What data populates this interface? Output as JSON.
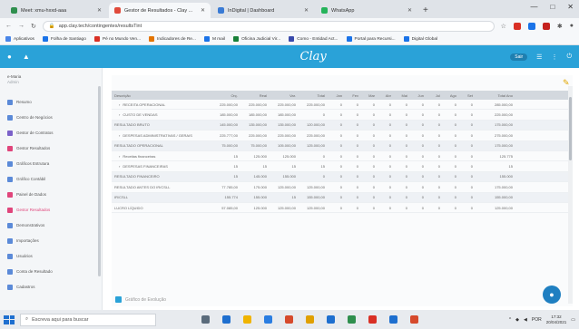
{
  "browser": {
    "tabs": [
      {
        "label": "Meet: xmu-hxxd-aaa",
        "active": false,
        "color": "#2f8f4e"
      },
      {
        "label": "Gestor de Resultados - Clay ...",
        "active": true,
        "color": "#e04a3b"
      },
      {
        "label": "InDigital | Dashboard",
        "active": false,
        "color": "#3a7bd5"
      },
      {
        "label": "WhatsApp",
        "active": false,
        "color": "#25b35a"
      }
    ],
    "new_tab": "+",
    "window_controls": [
      "—",
      "□",
      "✕"
    ],
    "address": "app.clay.tech/contingentes/resultsTint",
    "bookmarks": [
      {
        "label": "Aplicativos",
        "color": "#4a86e8"
      },
      {
        "label": "Folha de Santiago",
        "color": "#1a73e8"
      },
      {
        "label": "Pé no Mundo Ven...",
        "color": "#d93025"
      },
      {
        "label": "Indicadores de Re...",
        "color": "#e37400"
      },
      {
        "label": "M mail",
        "color": "#1a73e8"
      },
      {
        "label": "Oficina Judicial Vir...",
        "color": "#188038"
      },
      {
        "label": "Como - Entidad Act...",
        "color": "#3949ab"
      },
      {
        "label": "Portal para Recursi...",
        "color": "#1a73e8"
      },
      {
        "label": "Digital Global",
        "color": "#1a73e8"
      }
    ]
  },
  "app": {
    "brand": "Clay",
    "header_right_chip": "Sair",
    "accent": "#2aa2d8"
  },
  "sidebar": {
    "user": "e-Maria",
    "user_sub": "Admin",
    "items": [
      {
        "label": "Resumo",
        "color": "#5b8ad8"
      },
      {
        "label": "Centro de Negócios",
        "color": "#5b8ad8"
      },
      {
        "label": "Gestor de Contratos",
        "color": "#7b61c9"
      },
      {
        "label": "Gestor Resultados",
        "color": "#e0457b"
      },
      {
        "label": "Gráficos Estrutura",
        "color": "#5b8ad8"
      },
      {
        "label": "Gráfico Contábil",
        "color": "#5b8ad8"
      },
      {
        "label": "Painel de Dados",
        "color": "#e0457b"
      },
      {
        "label": "Gestor Resultados",
        "color": "#e0457b",
        "active": true
      },
      {
        "label": "Demonstrativos",
        "color": "#5b8ad8"
      },
      {
        "label": "Importações",
        "color": "#5b8ad8"
      },
      {
        "label": "Usuários",
        "color": "#5b8ad8"
      },
      {
        "label": "Conta de Resultado",
        "color": "#5b8ad8"
      },
      {
        "label": "Cadastros",
        "color": "#5b8ad8"
      }
    ]
  },
  "table": {
    "headers": [
      "Descrição",
      "Orç.",
      "Real",
      "Var.",
      "Total",
      "Jan",
      "Fev",
      "Mar",
      "Abr",
      "Mai",
      "Jun",
      "Jul",
      "Ago",
      "Set",
      "Total Ano"
    ],
    "rows": [
      {
        "name": "RECEITA OPERACIONAL",
        "twisty": "›",
        "indent": true,
        "band": false,
        "vals": [
          "225.000,00",
          "225.000,00",
          "225.000,00",
          "225.000,00",
          "0",
          "0",
          "0",
          "0",
          "0",
          "0",
          "0",
          "0",
          "0",
          "285.000,00"
        ]
      },
      {
        "name": "CUSTO DE VENDAS",
        "twisty": "›",
        "indent": true,
        "band": false,
        "vals": [
          "185.000,00",
          "185.000,00",
          "185.000,00",
          "0",
          "0",
          "0",
          "0",
          "0",
          "0",
          "0",
          "0",
          "0",
          "0",
          "225.000,00"
        ]
      },
      {
        "name": "RESULTADO BRUTO",
        "twisty": "",
        "indent": false,
        "band": true,
        "vals": [
          "145.000,00",
          "135.000,00",
          "135.000,00",
          "120.000,00",
          "0",
          "0",
          "0",
          "0",
          "0",
          "0",
          "0",
          "0",
          "0",
          "175.000,00"
        ]
      },
      {
        "name": "DESPESAS ADMINISTRATIVAS / GERAIS",
        "twisty": "›",
        "indent": true,
        "band": false,
        "vals": [
          "225.777,00",
          "225.000,00",
          "225.000,00",
          "225.000,00",
          "0",
          "0",
          "0",
          "0",
          "0",
          "0",
          "0",
          "0",
          "0",
          "275.000,00"
        ]
      },
      {
        "name": "RESULTADO OPERACIONAL",
        "twisty": "",
        "indent": false,
        "band": true,
        "vals": [
          "75.000,00",
          "75.000,00",
          "105.000,00",
          "125.000,00",
          "0",
          "0",
          "0",
          "0",
          "0",
          "0",
          "0",
          "0",
          "0",
          "175.000,00"
        ]
      },
      {
        "name": "Receitas financeiras",
        "twisty": "›",
        "indent": true,
        "band": false,
        "vals": [
          "15",
          "125.000",
          "125.000",
          "0",
          "0",
          "0",
          "0",
          "0",
          "0",
          "0",
          "0",
          "0",
          "0",
          "125.775"
        ]
      },
      {
        "name": "DESPESAS FINANCEIRAS",
        "twisty": "›",
        "indent": true,
        "band": false,
        "vals": [
          "15",
          "15",
          "15",
          "15",
          "0",
          "0",
          "0",
          "0",
          "0",
          "0",
          "0",
          "0",
          "0",
          "15"
        ]
      },
      {
        "name": "RESULTADO FINANCEIRO",
        "twisty": "",
        "indent": false,
        "band": true,
        "vals": [
          "15",
          "145.000",
          "155.000",
          "0",
          "0",
          "0",
          "0",
          "0",
          "0",
          "0",
          "0",
          "0",
          "0",
          "155.000"
        ]
      },
      {
        "name": "RESULTADO ANTES DO IR/CSLL",
        "twisty": "",
        "indent": false,
        "band": false,
        "vals": [
          "77.785,00",
          "175.000",
          "125.000,00",
          "125.000,00",
          "0",
          "0",
          "0",
          "0",
          "0",
          "0",
          "0",
          "0",
          "0",
          "175.000,00"
        ]
      },
      {
        "name": "IR/CSLL",
        "twisty": "",
        "indent": false,
        "band": true,
        "vals": [
          "155.774",
          "155.000",
          "15",
          "155.000,00",
          "0",
          "0",
          "0",
          "0",
          "0",
          "0",
          "0",
          "0",
          "0",
          "155.000,00"
        ]
      },
      {
        "name": "LUCRO LÍQUIDO",
        "twisty": "",
        "indent": false,
        "band": false,
        "vals": [
          "57.085,00",
          "125.000",
          "125.000,00",
          "125.000,00",
          "0",
          "0",
          "0",
          "0",
          "0",
          "0",
          "0",
          "0",
          "0",
          "125.000,00"
        ]
      }
    ]
  },
  "chart_toggle": "Gráfico de Evolução",
  "taskbar": {
    "search_placeholder": "Escreva aqui para buscar",
    "apps": [
      "#5a6b7b",
      "#1e6fcf",
      "#f0b400",
      "#2a7de1",
      "#d64a2c",
      "#e0a000",
      "#1e6fcf",
      "#2f8f4e",
      "#d93025",
      "#1e6fcf",
      "#d64a2c"
    ],
    "lang": "POR",
    "time": "17:32",
    "date": "20/04/2021"
  }
}
